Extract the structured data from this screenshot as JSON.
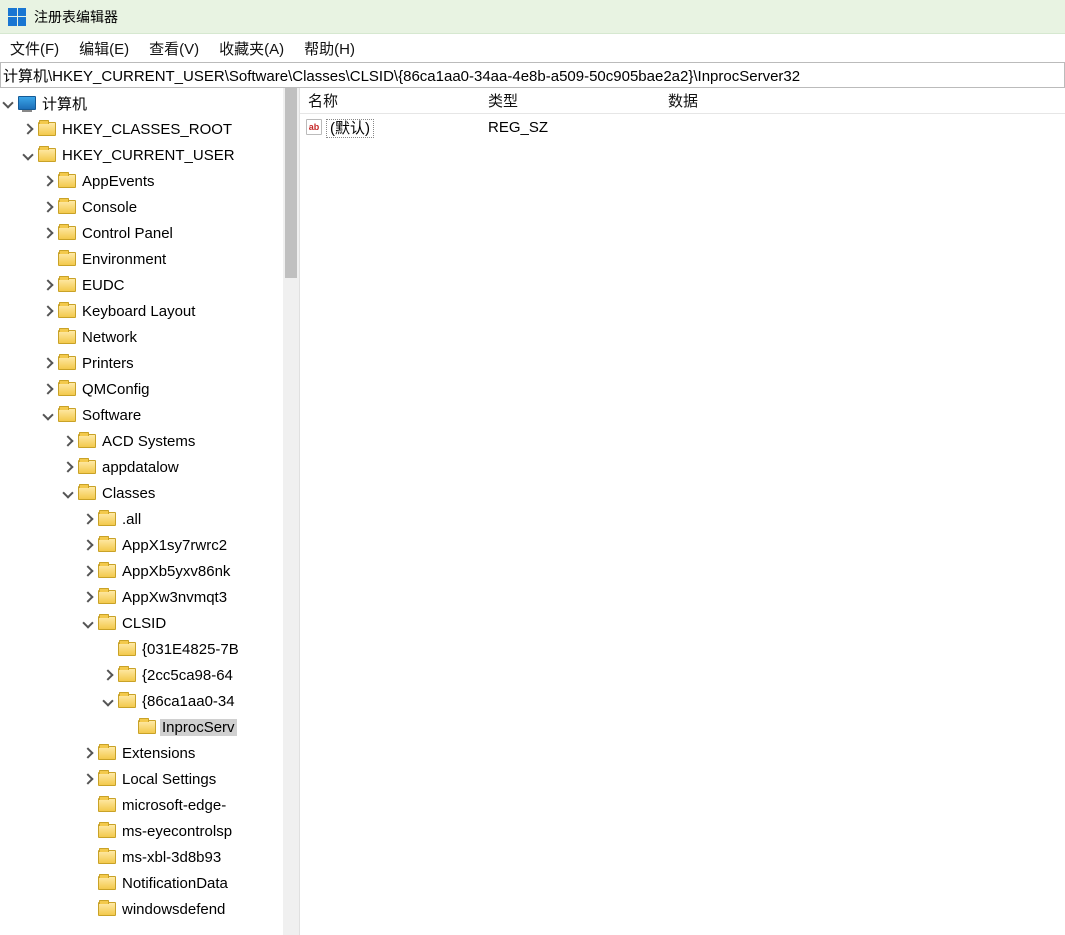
{
  "window": {
    "title": "注册表编辑器"
  },
  "menu": {
    "file": "文件(F)",
    "edit": "编辑(E)",
    "view": "查看(V)",
    "favorites": "收藏夹(A)",
    "help": "帮助(H)"
  },
  "address": "计算机\\HKEY_CURRENT_USER\\Software\\Classes\\CLSID\\{86ca1aa0-34aa-4e8b-a509-50c905bae2a2}\\InprocServer32",
  "columns": {
    "name": "名称",
    "type": "类型",
    "data": "数据"
  },
  "values": [
    {
      "name": "(默认)",
      "type": "REG_SZ",
      "data": ""
    }
  ],
  "tree": [
    {
      "depth": 0,
      "expander": "down",
      "icon": "pc",
      "label": "计算机"
    },
    {
      "depth": 1,
      "expander": "right",
      "icon": "folder",
      "label": "HKEY_CLASSES_ROOT"
    },
    {
      "depth": 1,
      "expander": "down",
      "icon": "folder",
      "label": "HKEY_CURRENT_USER"
    },
    {
      "depth": 2,
      "expander": "right",
      "icon": "folder",
      "label": "AppEvents"
    },
    {
      "depth": 2,
      "expander": "right",
      "icon": "folder",
      "label": "Console"
    },
    {
      "depth": 2,
      "expander": "right",
      "icon": "folder",
      "label": "Control Panel"
    },
    {
      "depth": 2,
      "expander": "none",
      "icon": "folder",
      "label": "Environment"
    },
    {
      "depth": 2,
      "expander": "right",
      "icon": "folder",
      "label": "EUDC"
    },
    {
      "depth": 2,
      "expander": "right",
      "icon": "folder",
      "label": "Keyboard Layout"
    },
    {
      "depth": 2,
      "expander": "none",
      "icon": "folder",
      "label": "Network"
    },
    {
      "depth": 2,
      "expander": "right",
      "icon": "folder",
      "label": "Printers"
    },
    {
      "depth": 2,
      "expander": "right",
      "icon": "folder",
      "label": "QMConfig"
    },
    {
      "depth": 2,
      "expander": "down",
      "icon": "folder",
      "label": "Software"
    },
    {
      "depth": 3,
      "expander": "right",
      "icon": "folder",
      "label": "ACD Systems"
    },
    {
      "depth": 3,
      "expander": "right",
      "icon": "folder",
      "label": "appdatalow"
    },
    {
      "depth": 3,
      "expander": "down",
      "icon": "folder",
      "label": "Classes"
    },
    {
      "depth": 4,
      "expander": "right",
      "icon": "folder",
      "label": ".all"
    },
    {
      "depth": 4,
      "expander": "right",
      "icon": "folder",
      "label": "AppX1sy7rwrc2"
    },
    {
      "depth": 4,
      "expander": "right",
      "icon": "folder",
      "label": "AppXb5yxv86nk"
    },
    {
      "depth": 4,
      "expander": "right",
      "icon": "folder",
      "label": "AppXw3nvmqt3"
    },
    {
      "depth": 4,
      "expander": "down",
      "icon": "folder",
      "label": "CLSID"
    },
    {
      "depth": 5,
      "expander": "none",
      "icon": "folder",
      "label": "{031E4825-7B"
    },
    {
      "depth": 5,
      "expander": "right",
      "icon": "folder",
      "label": "{2cc5ca98-64"
    },
    {
      "depth": 5,
      "expander": "down",
      "icon": "folder",
      "label": "{86ca1aa0-34"
    },
    {
      "depth": 6,
      "expander": "none",
      "icon": "folder",
      "label": "InprocServ",
      "selected": true
    },
    {
      "depth": 4,
      "expander": "right",
      "icon": "folder",
      "label": "Extensions"
    },
    {
      "depth": 4,
      "expander": "right",
      "icon": "folder",
      "label": "Local Settings"
    },
    {
      "depth": 4,
      "expander": "none",
      "icon": "folder",
      "label": "microsoft-edge-"
    },
    {
      "depth": 4,
      "expander": "none",
      "icon": "folder",
      "label": "ms-eyecontrolsp"
    },
    {
      "depth": 4,
      "expander": "none",
      "icon": "folder",
      "label": "ms-xbl-3d8b93"
    },
    {
      "depth": 4,
      "expander": "none",
      "icon": "folder",
      "label": "NotificationData"
    },
    {
      "depth": 4,
      "expander": "none",
      "icon": "folder",
      "label": "windowsdefend"
    }
  ]
}
